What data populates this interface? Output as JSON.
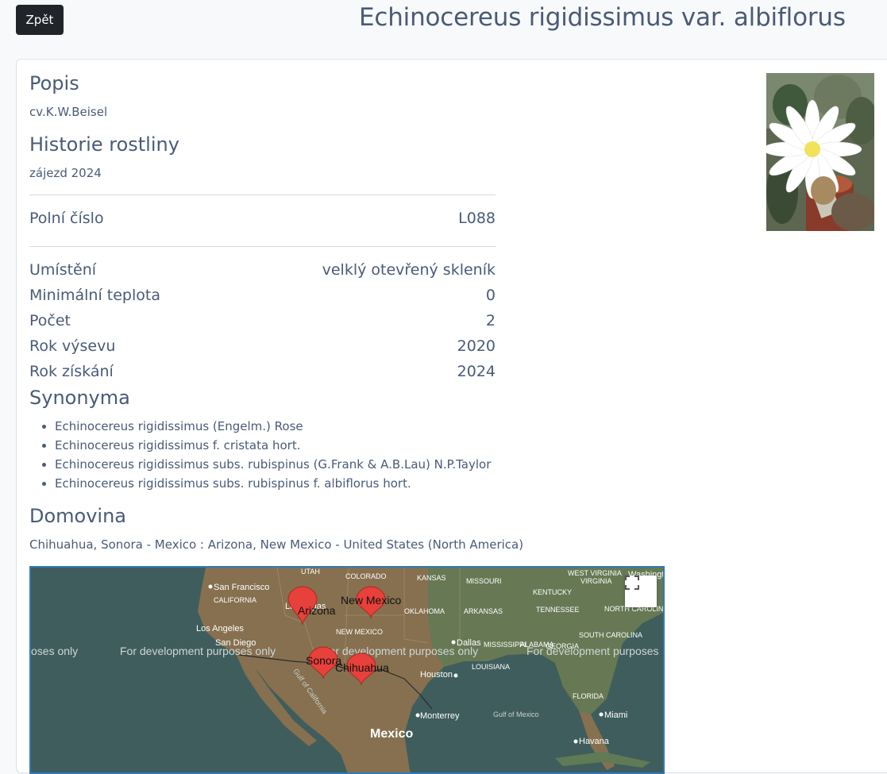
{
  "header": {
    "back_label": "Zpět",
    "title": "Echinocereus rigidissimus var. albiflorus"
  },
  "popis": {
    "heading": "Popis",
    "text": "cv.K.W.Beisel"
  },
  "historie": {
    "heading": "Historie rostliny",
    "text": "zájezd 2024"
  },
  "field_number": {
    "label": "Polní číslo",
    "value": "L088"
  },
  "details": [
    {
      "label": "Umístění",
      "value": "velklý otevřený skleník"
    },
    {
      "label": "Minimální teplota",
      "value": "0"
    },
    {
      "label": "Počet",
      "value": "2"
    },
    {
      "label": "Rok výsevu",
      "value": "2020"
    },
    {
      "label": "Rok získání",
      "value": "2024"
    }
  ],
  "synonyma": {
    "heading": "Synonyma",
    "items": [
      "Echinocereus rigidissimus (Engelm.) Rose",
      "Echinocereus rigidissimus f. cristata hort.",
      "Echinocereus rigidissimus subs. rubispinus (G.Frank & A.B.Lau) N.P.Taylor",
      "Echinocereus rigidissimus subs. rubispinus f. albiflorus hort."
    ]
  },
  "domovina": {
    "heading": "Domovina",
    "text": "Chihuahua, Sonora - Mexico : Arizona, New Mexico - United States (North America)"
  },
  "map": {
    "watermark": "For development purposes only",
    "watermark_left": "oses only",
    "watermark_right": "For development purposes",
    "markers": [
      "Arizona",
      "New Mexico",
      "Sonora",
      "Chihuahua"
    ],
    "cities": [
      "San Francisco",
      "Las Vegas",
      "Los Angeles",
      "San Diego",
      "Dallas",
      "Houston",
      "Monterrey",
      "Mexico",
      "Miami",
      "Havana",
      "Washington"
    ],
    "states": [
      "UTAH",
      "COLORADO",
      "KANSAS",
      "MISSOURI",
      "KENTUCKY",
      "VIRGINIA",
      "WEST VIRGINIA",
      "CALIFORNIA",
      "OKLAHOMA",
      "ARKANSAS",
      "TENNESSEE",
      "NORTH CAROLINA",
      "NEW MEXICO",
      "SOUTH CAROLINA",
      "GEORGIA",
      "ALABAMA",
      "MISSISSIPPI",
      "LOUISIANA",
      "FLORIDA"
    ],
    "water_labels": [
      "Gulf of California",
      "Gulf of Mexico"
    ],
    "marker_color": "#e8403a",
    "land_color": "#86704f",
    "water_color": "#3f5d5c"
  }
}
